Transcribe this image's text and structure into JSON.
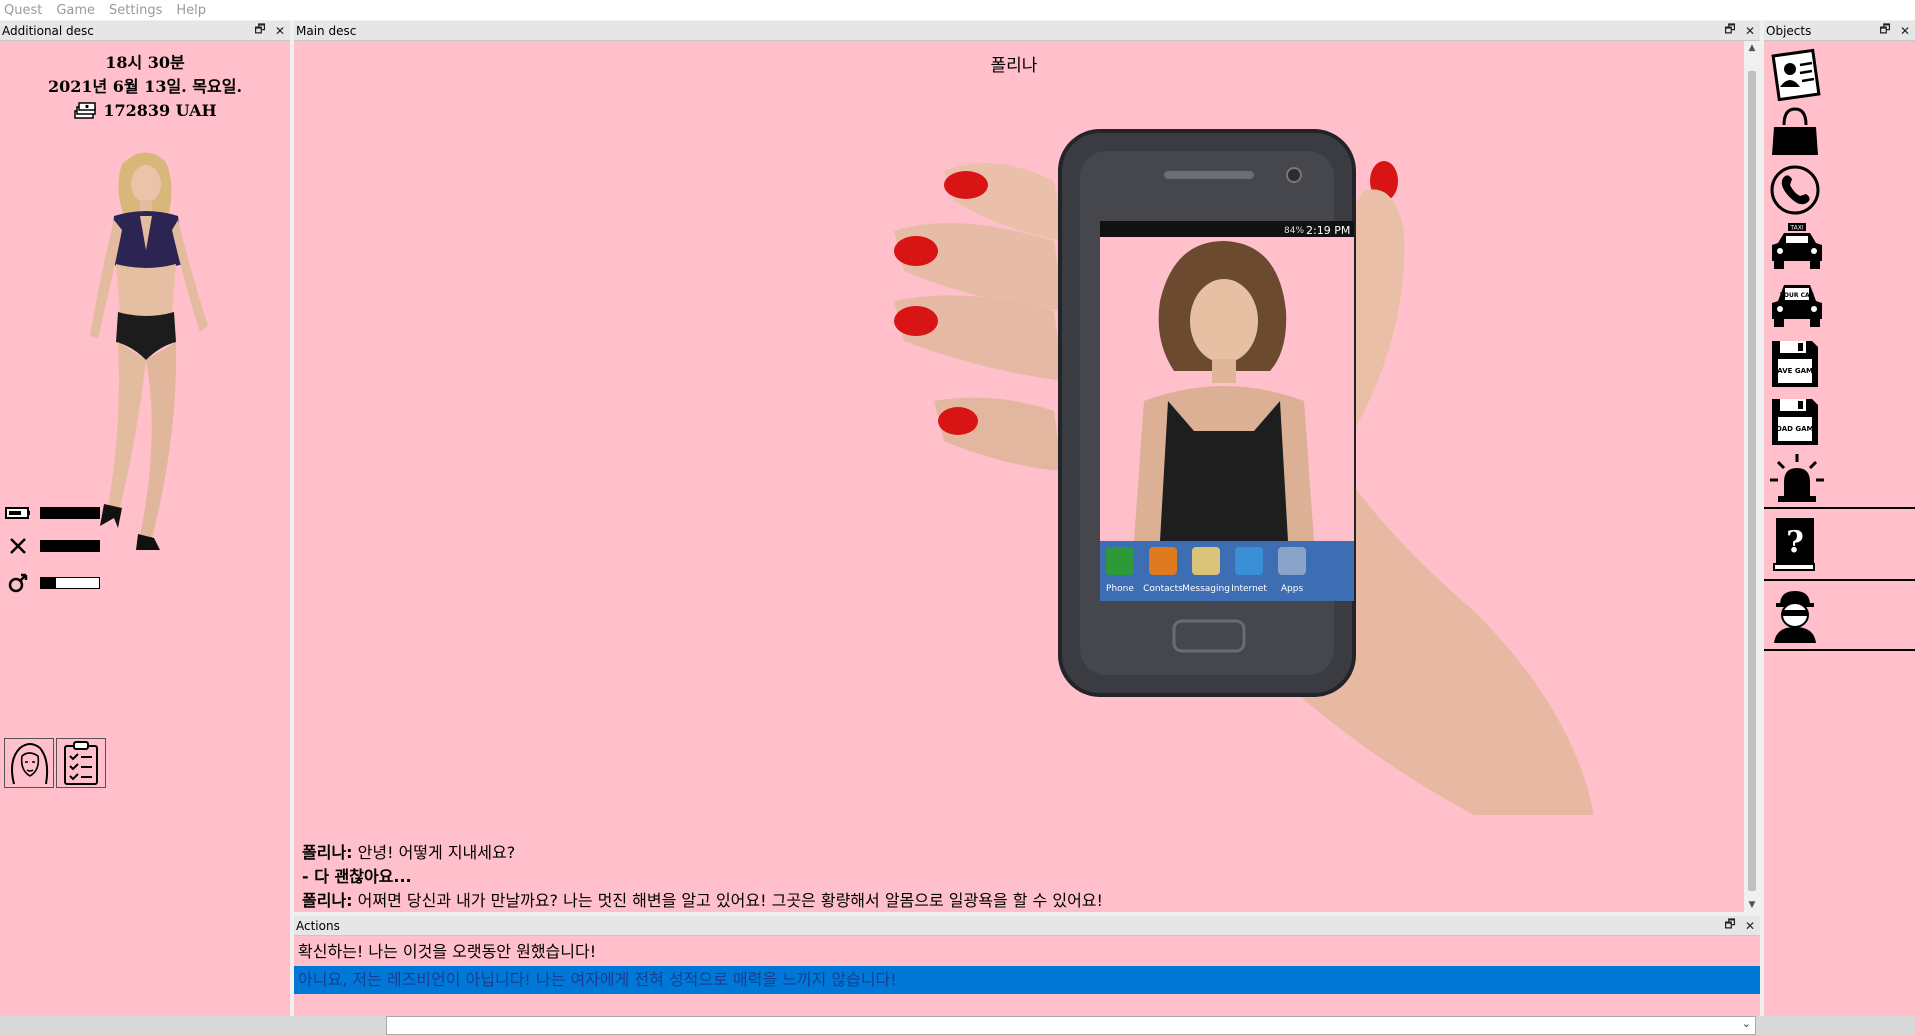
{
  "menu": [
    "Quest",
    "Game",
    "Settings",
    "Help"
  ],
  "panels": {
    "additional": "Additional desc",
    "main": "Main desc",
    "objects": "Objects",
    "actions": "Actions"
  },
  "window_buttons": {
    "restore": "🗗",
    "close": "✕"
  },
  "status": {
    "time": "18시 30분",
    "date": "2021년 6월 13일. 목요일.",
    "money": "172839 UAH"
  },
  "stats": [
    {
      "icon": "energy-icon",
      "level": 1.0
    },
    {
      "icon": "food-icon",
      "level": 1.0
    },
    {
      "icon": "arousal-icon",
      "level": 0.25
    }
  ],
  "scene_title": "폴리나",
  "phone": {
    "status_time": "2:19 PM",
    "battery": "84%",
    "dock": [
      "Phone",
      "Contacts",
      "Messaging",
      "Internet",
      "Apps"
    ]
  },
  "dialogue": [
    {
      "speaker": "폴리나:",
      "text": " 안녕! 어떻게 지내세요?"
    },
    {
      "speaker": "",
      "text": "- 다 괜찮아요..."
    },
    {
      "speaker": "폴리나:",
      "text": " 어쩌면 당신과 내가 만날까요? 나는 멋진 해변을 알고 있어요! 그곳은 황량해서 알몸으로 일광욕을 할 수 있어요!"
    }
  ],
  "actions": [
    {
      "label": "확신하는! 나는 이것을 오랫동안 원했습니다!",
      "selected": false
    },
    {
      "label": "아니요, 저는 레즈비언이 아닙니다! 나는 여자에게 전혀 성적으로 매력을 느끼지 않습니다!",
      "selected": true
    }
  ],
  "objects": [
    {
      "icon": "id-card-icon"
    },
    {
      "icon": "handbag-icon"
    },
    {
      "icon": "phone-icon"
    },
    {
      "icon": "taxi-icon",
      "label": "TAXI"
    },
    {
      "icon": "your-car-icon",
      "label": "YOUR CAR"
    },
    {
      "icon": "save-game-icon",
      "label": "SAVE GAME"
    },
    {
      "icon": "load-game-icon",
      "label": "LOAD GAME"
    },
    {
      "icon": "alarm-siren-icon"
    },
    {
      "icon": "help-book-icon"
    },
    {
      "icon": "thief-icon"
    }
  ],
  "colors": {
    "panel_bg": "#ffc0cb",
    "selection": "#0078d7",
    "nail": "#d81414"
  }
}
